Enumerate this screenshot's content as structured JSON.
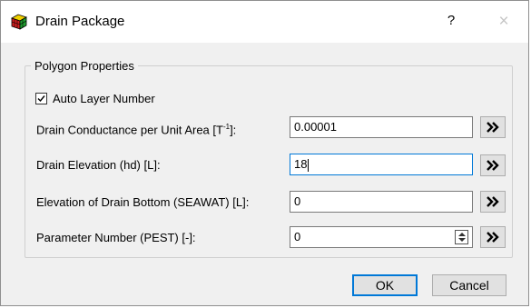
{
  "window": {
    "title": "Drain Package",
    "help_label": "?",
    "close_label": "×"
  },
  "group": {
    "title": "Polygon Properties",
    "auto_layer": {
      "label": "Auto Layer Number",
      "checked": true
    }
  },
  "fields": [
    {
      "label_pre": "Drain Conductance per Unit Area [T",
      "label_sup": "-1",
      "label_post": "]:",
      "value": "0.00001"
    },
    {
      "label": "Drain Elevation (hd) [L]:",
      "value": "18"
    },
    {
      "label": "Elevation of Drain Bottom (SEAWAT) [L]:",
      "value": "0"
    },
    {
      "label": "Parameter Number (PEST) [-]:",
      "value": "0"
    }
  ],
  "buttons": {
    "ok": "OK",
    "cancel": "Cancel"
  },
  "icons": {
    "app": "cube-icon",
    "more": "double-chevron-right-icon"
  }
}
